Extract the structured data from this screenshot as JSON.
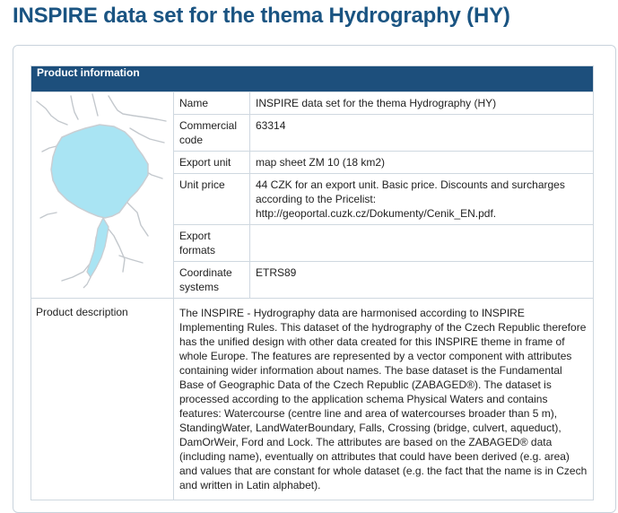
{
  "page": {
    "title": "INSPIRE data set for the thema Hydrography (HY)"
  },
  "panel": {
    "header": "Product information",
    "rows": [
      {
        "label": "Name",
        "value": "INSPIRE data set for the thema Hydrography (HY)"
      },
      {
        "label": "Commercial code",
        "value": "63314"
      },
      {
        "label": "Export unit",
        "value": "map sheet ZM 10 (18 km2)"
      },
      {
        "label": "Unit price",
        "value": "44 CZK for an export unit. Basic price. Discounts and surcharges according to the Pricelist: http://geoportal.cuzk.cz/Dokumenty/Cenik_EN.pdf."
      },
      {
        "label": "Export formats",
        "value": ""
      },
      {
        "label": "Coordinate systems",
        "value": "ETRS89"
      }
    ],
    "description_label": "Product description",
    "description": "The INSPIRE - Hydrography data are harmonised according to INSPIRE Implementing Rules. This dataset of the hydrography of the Czech Republic therefore has the unified design with other data created for this INSPIRE theme in frame of whole Europe. The features are represented by a vector component with attributes containing wider information about names. The base dataset is the Fundamental Base of Geographic Data of the Czech Republic (ZABAGED®). The dataset is processed according to the application schema Physical Waters and contains features: Watercourse (centre line and area of watercourses broader than 5 m), StandingWater, LandWaterBoundary, Falls, Crossing (bridge, culvert, aqueduct), DamOrWeir, Ford and Lock. The attributes are based on the ZABAGED® data (including name), eventually on attributes that could have been derived (e.g. area) and values that are constant for whole dataset (e.g. the fact that the name is in Czech and written in Latin alphabet)."
  },
  "colors": {
    "title": "#1a5482",
    "header_bg": "#1d4f7c",
    "water": "#a9e4f3",
    "water_edge": "#c9ced3"
  }
}
